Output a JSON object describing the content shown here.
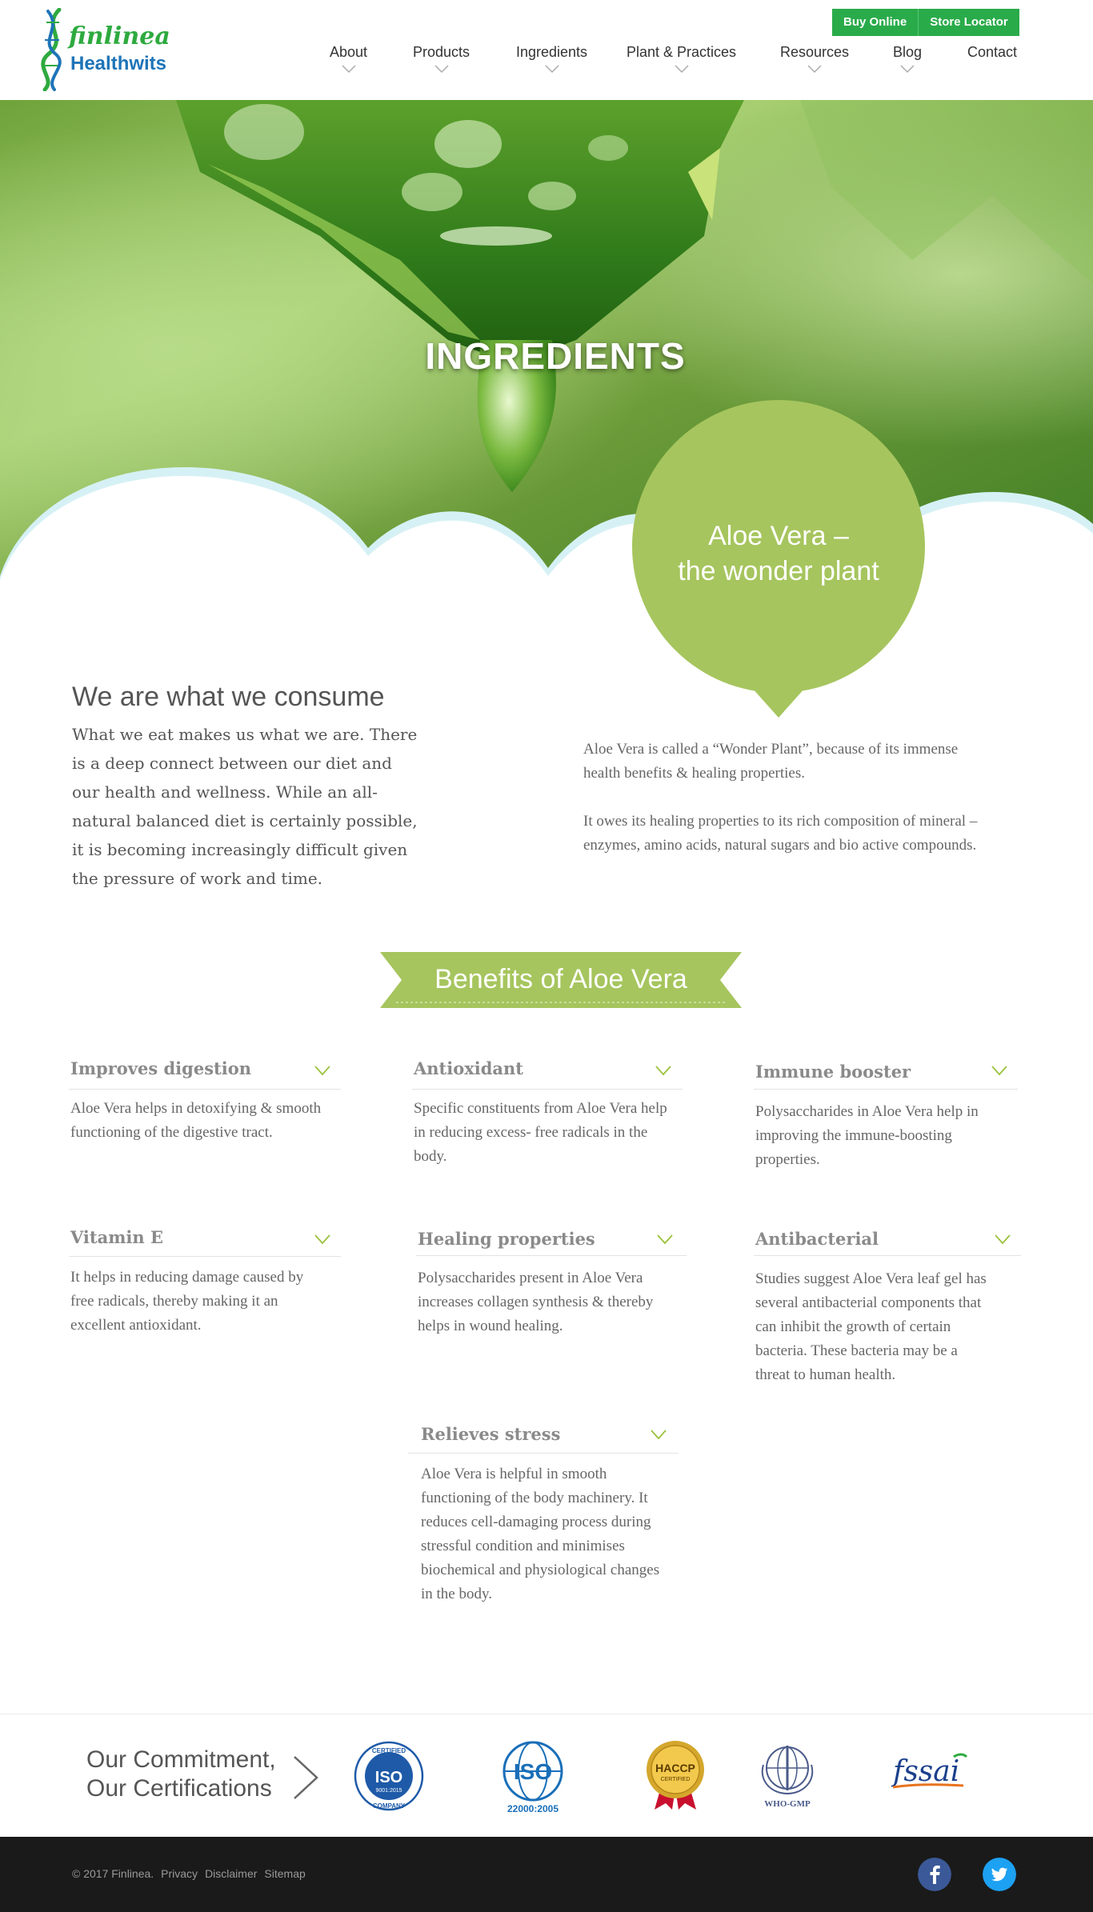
{
  "header": {
    "logo_line1": "finlinea",
    "logo_line2": "Healthwits",
    "buy_online": "Buy Online",
    "store_locator": "Store Locator",
    "nav": [
      "About",
      "Products",
      "Ingredients",
      "Plant & Practices",
      "Resources",
      "Blog",
      "Contact"
    ]
  },
  "hero": {
    "title": "INGREDIENTS",
    "bubble_line1": "Aloe Vera –",
    "bubble_line2": "the wonder plant"
  },
  "intro": {
    "title": "We are what we consume",
    "text": "What we eat makes us what we are. There is a deep connect between our diet and our health and wellness. While an all-natural balanced diet is certainly possible, it is becoming increasingly difficult given the pressure of work and time.",
    "para1": "Aloe Vera is called a “Wonder Plant”, because of its immense health benefits & healing properties.",
    "para2": "It owes its healing properties to its rich composition of mineral – enzymes, amino acids, natural sugars and bio active compounds."
  },
  "benefits": {
    "heading": "Benefits of Aloe Vera",
    "items": [
      {
        "title": "Improves digestion",
        "text": "Aloe Vera helps in detoxifying & smooth functioning of the digestive tract."
      },
      {
        "title": "Antioxidant",
        "text": "Specific constituents from Aloe Vera help in reducing excess- free radicals in the body."
      },
      {
        "title": "Immune booster",
        "text": "Polysaccharides in Aloe Vera help in improving the immune-boosting properties."
      },
      {
        "title": "Vitamin E",
        "text": "It helps in reducing damage caused by free radicals, thereby making it an excellent antioxidant."
      },
      {
        "title": "Healing properties",
        "text": "Polysaccharides present in Aloe Vera increases collagen synthesis & thereby helps in wound healing."
      },
      {
        "title": "Antibacterial",
        "text": "Studies suggest Aloe Vera leaf gel has several antibacterial components that can inhibit the growth of certain bacteria. These bacteria may be a threat to human health."
      },
      {
        "title": "Relieves stress",
        "text": "Aloe Vera is helpful in smooth functioning of the body machinery. It reduces cell-damaging process during stressful condition and minimises biochemical and physiological changes in the body."
      }
    ]
  },
  "certifications": {
    "title_line1": "Our Commitment,",
    "title_line2": "Our Certifications",
    "iso1_top": "CERTIFIED",
    "iso1_mid": "ISO",
    "iso1_num": "9001:2015",
    "iso1_bottom": "COMPANY",
    "iso2_mid": "ISO",
    "iso2_num": "22000:2005",
    "haccp": "HACCP",
    "haccp_sub": "CERTIFIED",
    "who": "WHO-GMP",
    "fssai": "fssai"
  },
  "footer": {
    "copyright": "© 2017 Finlinea.",
    "privacy": "Privacy",
    "disclaimer": "Disclaimer",
    "sitemap": "Sitemap"
  },
  "colors": {
    "brand_green": "#2aab4a",
    "leaf_green": "#a6c55e",
    "chevron_green": "#9bc23c",
    "footer_bg": "#1a1a1a"
  }
}
